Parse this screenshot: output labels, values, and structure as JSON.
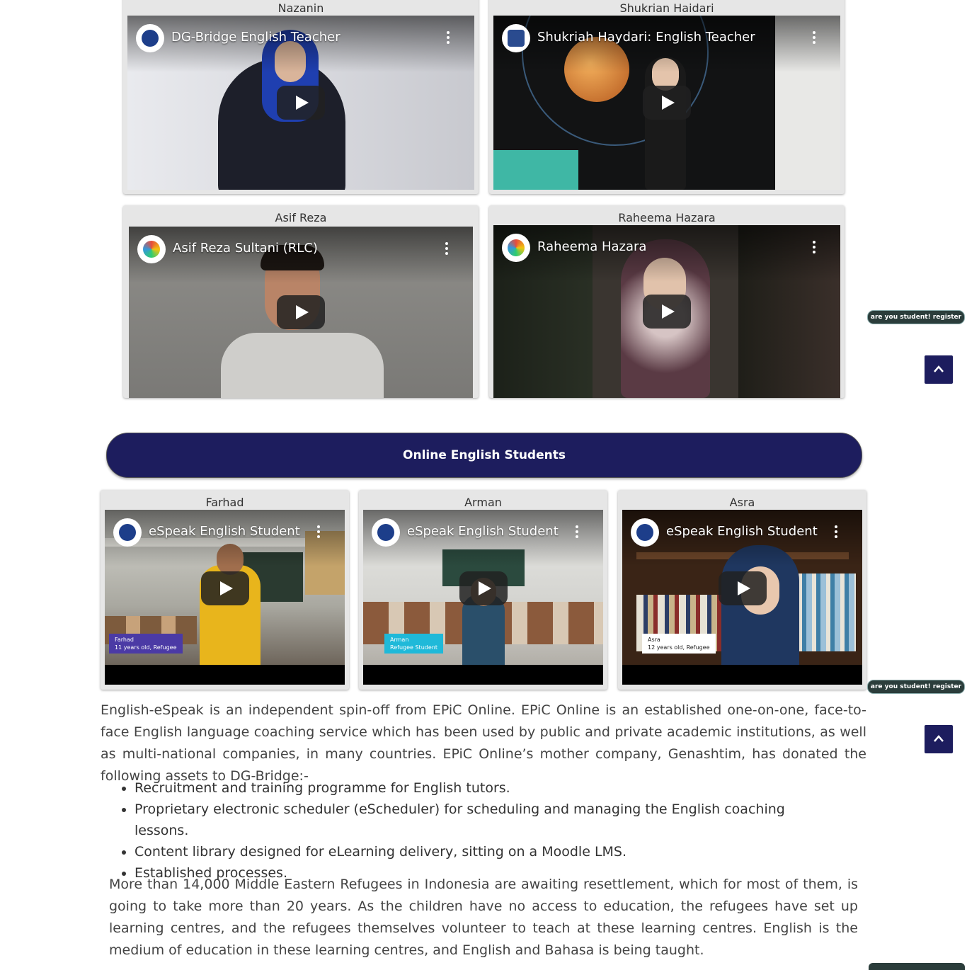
{
  "teacher_cards": [
    {
      "name": "Nazanin",
      "video_title": "DG-Bridge English Teacher"
    },
    {
      "name": "Shukrian Haidari",
      "video_title": "Shukriah Haydari: English Teacher"
    },
    {
      "name": "Asif Reza",
      "video_title": "Asif Reza Sultani (RLC)"
    },
    {
      "name": "Raheema Hazara",
      "video_title": "Raheema Hazara"
    }
  ],
  "students_heading": "Online English Students",
  "student_cards": [
    {
      "name": "Farhad",
      "video_title": "eSpeak English Student",
      "caption_name": "Farhad",
      "caption_info": "11 years old, Refugee"
    },
    {
      "name": "Arman",
      "video_title": "eSpeak English Student",
      "caption_name": "Arman",
      "caption_info": "Refugee Student"
    },
    {
      "name": "Asra",
      "video_title": "eSpeak English Student",
      "caption_name": "Asra",
      "caption_info": "12 years old, Refugee"
    }
  ],
  "register_label": "are you student! register here",
  "intro_paragraph": "English-eSpeak is an independent spin-off from EPiC Online. EPiC Online is an established one-on-one, face-to-face English language coaching service which has been used by public and private academic institutions, as well as multi-national companies, in many countries. EPiC Online’s mother company, Genashtim, has donated the following assets to DG-Bridge:-",
  "assets": [
    "Recruitment and training programme for English tutors.",
    "Proprietary electronic scheduler (eScheduler) for scheduling and managing the English coaching lessons.",
    "Content library designed for eLearning delivery, sitting on a Moodle LMS.",
    "Established processes."
  ],
  "refugee_paragraph": "More than 14,000 Middle Eastern Refugees in Indonesia are awaiting resettlement, which for most of them, is going to take more than 20 years. As the children have no access to education, the refugees have set up learning centres, and the refugees themselves volunteer to teach at these learning centres. English is the medium of education in these learning centres, and English and Bahasa is being taught.",
  "colors": {
    "navy": "#1d1d5e",
    "register_bg": "#2b3d3b",
    "card_bg": "#e6e6e6"
  }
}
